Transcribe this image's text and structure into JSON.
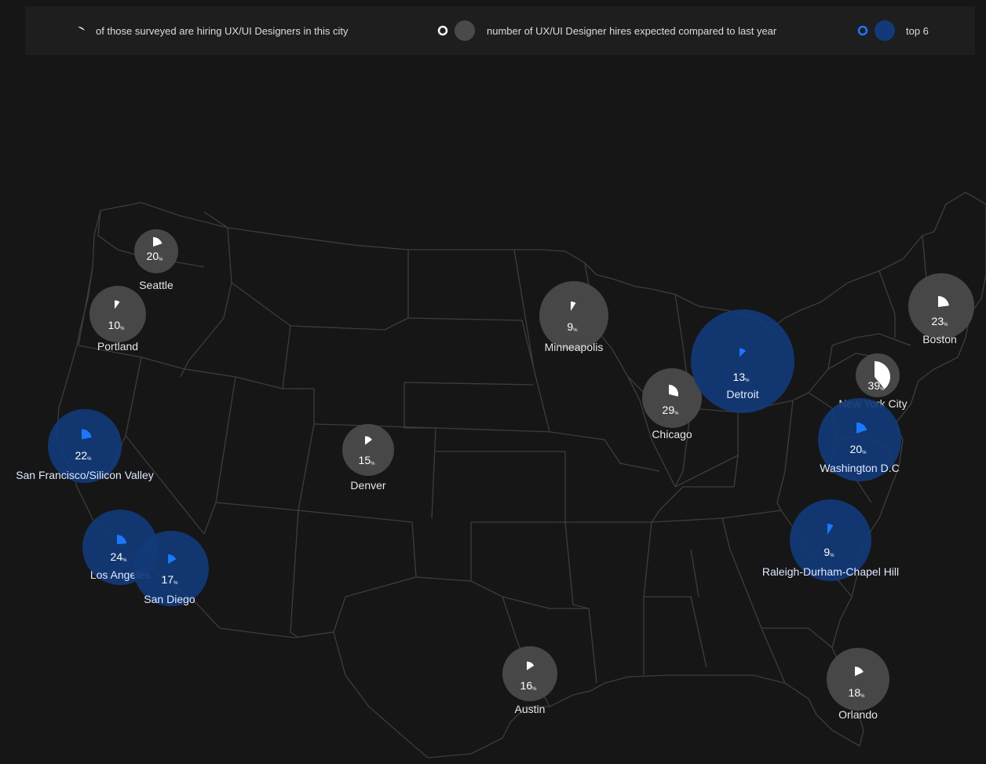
{
  "legend": {
    "hiring_text": "of those surveyed are hiring UX/UI Designers in this city",
    "hires_text": "number of UX/UI Designer hires expected compared to last year",
    "top6_text": "top 6"
  },
  "colors": {
    "background": "#161616",
    "gray_bubble": "#4a4a4a",
    "top6_bubble": "#123a78",
    "top6_pie": "#1a78ff",
    "gray_pie": "#ffffff",
    "state_lines": "#3d3d3d"
  },
  "percent_unit": "%",
  "cities": [
    {
      "name": "Seattle",
      "percent": 20,
      "top6": false
    },
    {
      "name": "Portland",
      "percent": 10,
      "top6": false
    },
    {
      "name": "San Francisco/Silicon Valley",
      "percent": 22,
      "top6": true
    },
    {
      "name": "Los Angeles",
      "percent": 24,
      "top6": true
    },
    {
      "name": "San Diego",
      "percent": 17,
      "top6": true
    },
    {
      "name": "Denver",
      "percent": 15,
      "top6": false
    },
    {
      "name": "Minneapolis",
      "percent": 9,
      "top6": false
    },
    {
      "name": "Austin",
      "percent": 16,
      "top6": false
    },
    {
      "name": "Chicago",
      "percent": 29,
      "top6": false
    },
    {
      "name": "Detroit",
      "percent": 13,
      "top6": true
    },
    {
      "name": "New York City",
      "percent": 39,
      "top6": false
    },
    {
      "name": "Boston",
      "percent": 23,
      "top6": false
    },
    {
      "name": "Washington D.C",
      "percent": 20,
      "top6": true
    },
    {
      "name": "Raleigh-Durham-Chapel Hill",
      "percent": 9,
      "top6": true
    },
    {
      "name": "Orlando",
      "percent": 18,
      "top6": false
    }
  ]
}
